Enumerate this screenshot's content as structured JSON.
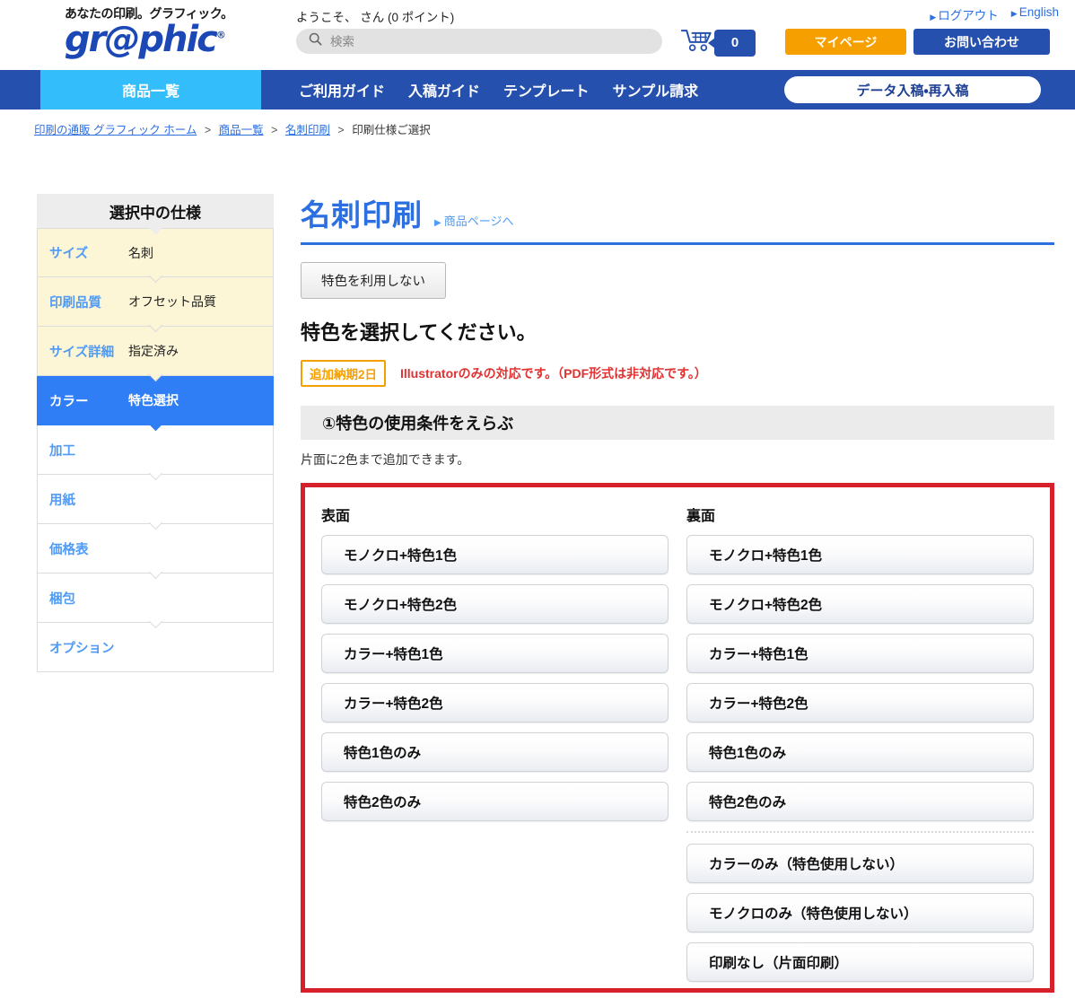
{
  "header": {
    "tagline": "あなたの印刷。グラフィック。",
    "logo": "gr@phic",
    "logo_tm": "®",
    "welcome": "ようこそ、 さん (0 ポイント)",
    "search_placeholder": "検索",
    "search_value": "",
    "cart_count": "0",
    "logout_label": "ログアウト",
    "english_label": "English",
    "mypage_label": "マイページ",
    "contact_label": "お問い合わせ",
    "accent_blue": "#2650ad",
    "accent_orange": "#f59f00"
  },
  "nav": {
    "featured": "商品一覧",
    "items": [
      {
        "label": "ご利用ガイド"
      },
      {
        "label": "入稿ガイド"
      },
      {
        "label": "テンプレート"
      },
      {
        "label": "サンプル請求"
      }
    ],
    "cta": "データ入稿・再入稿",
    "featured_color": "#33bdfb",
    "bar_color": "#2650ad"
  },
  "breadcrumb": {
    "items": [
      {
        "label": "印刷の通販 グラフィック ホーム",
        "link": true
      },
      {
        "label": "商品一覧",
        "link": true
      },
      {
        "label": "名刺印刷",
        "link": true
      },
      {
        "label": "印刷仕様ご選択",
        "link": false
      }
    ],
    "separator": ">"
  },
  "sidebar": {
    "title": "選択中の仕様",
    "rows": [
      {
        "key": "サイズ",
        "value": "名刺",
        "state": "filled"
      },
      {
        "key": "印刷品質",
        "value": "オフセット品質",
        "state": "filled"
      },
      {
        "key": "サイズ詳細",
        "value": "指定済み",
        "state": "filled"
      },
      {
        "key": "カラー",
        "value": "特色選択",
        "state": "active"
      },
      {
        "key": "加工",
        "value": "",
        "state": "empty"
      },
      {
        "key": "用紙",
        "value": "",
        "state": "empty"
      },
      {
        "key": "価格表",
        "value": "",
        "state": "empty"
      },
      {
        "key": "梱包",
        "value": "",
        "state": "empty"
      },
      {
        "key": "オプション",
        "value": "",
        "state": "empty"
      }
    ]
  },
  "main": {
    "page_title": "名刺印刷",
    "page_link": "商品ページへ",
    "no_spot_button": "特色を利用しない",
    "heading": "特色を選択してください。",
    "badge_days": "追加納期2日",
    "note": "Illustratorのみの対応です。（PDF形式は非対応です。）",
    "band_title": "①特色の使用条件をえらぶ",
    "band_note": "片面に2色まで追加できます。"
  },
  "panel": {
    "border_color": "#d6202a",
    "front": {
      "heading": "表面",
      "options": [
        {
          "label": "モノクロ+特色1色"
        },
        {
          "label": "モノクロ+特色2色"
        },
        {
          "label": "カラー+特色1色"
        },
        {
          "label": "カラー+特色2色"
        },
        {
          "label": "特色1色のみ"
        },
        {
          "label": "特色2色のみ"
        }
      ],
      "extra_options": []
    },
    "back": {
      "heading": "裏面",
      "options": [
        {
          "label": "モノクロ+特色1色"
        },
        {
          "label": "モノクロ+特色2色"
        },
        {
          "label": "カラー+特色1色"
        },
        {
          "label": "カラー+特色2色"
        },
        {
          "label": "特色1色のみ"
        },
        {
          "label": "特色2色のみ"
        }
      ],
      "extra_options": [
        {
          "label": "カラーのみ（特色使用しない）"
        },
        {
          "label": "モノクロのみ（特色使用しない）"
        },
        {
          "label": "印刷なし（片面印刷）"
        }
      ]
    }
  }
}
